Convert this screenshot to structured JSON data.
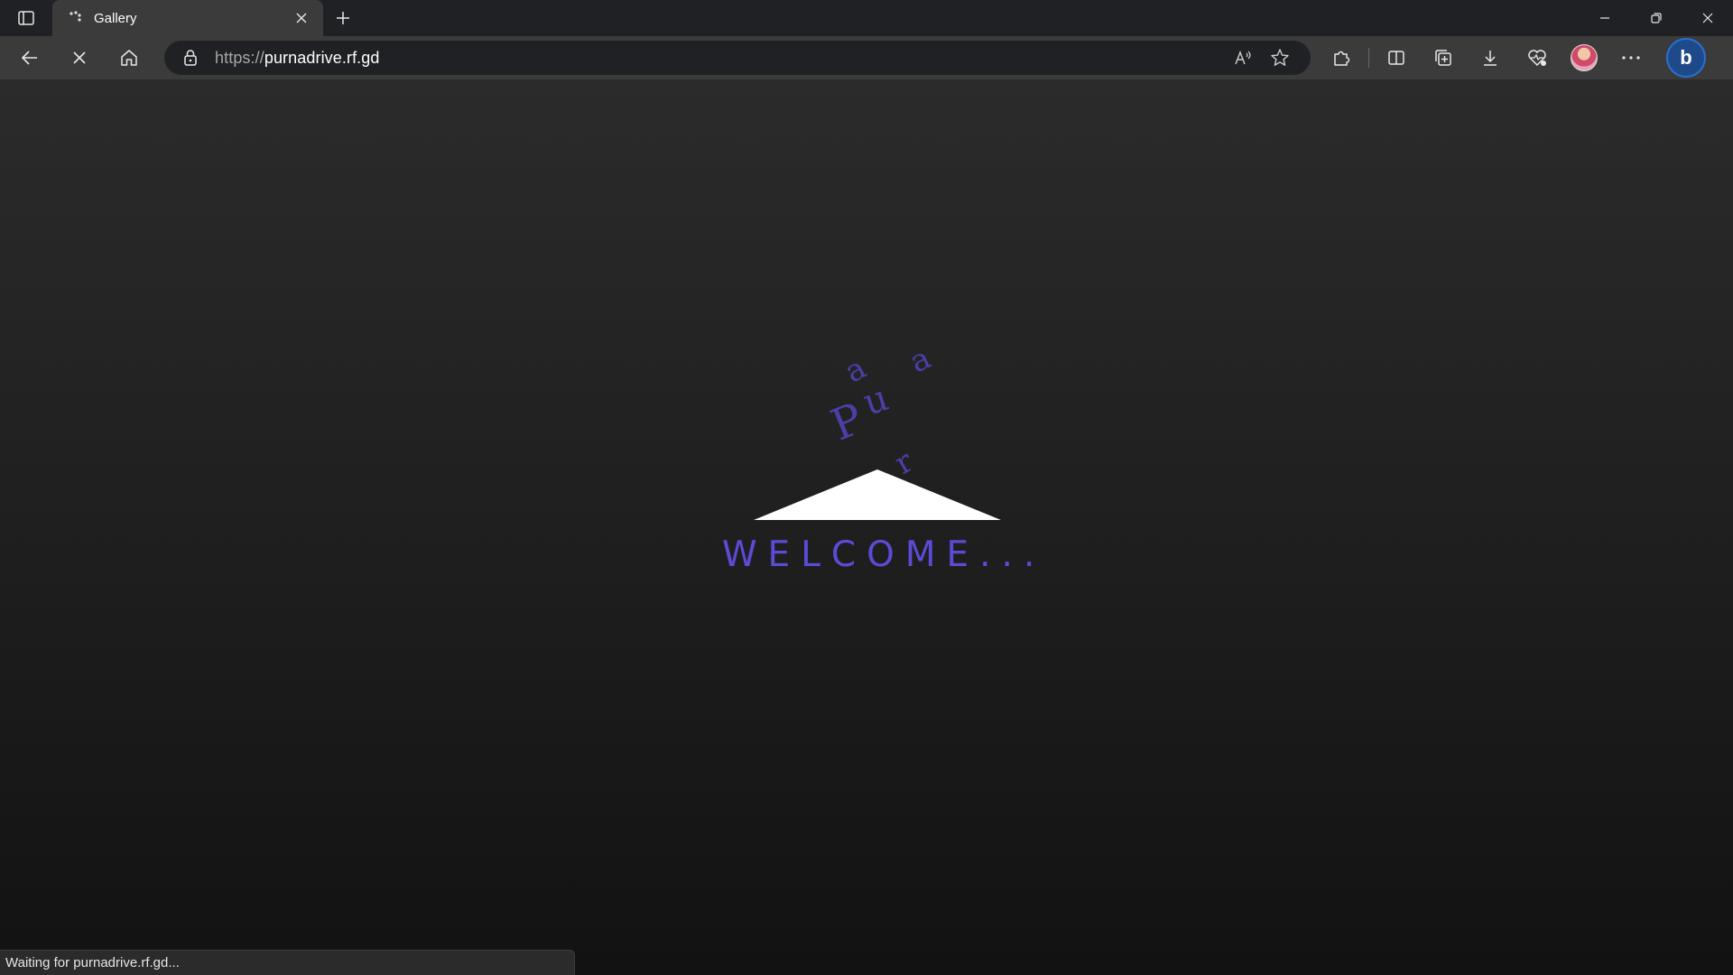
{
  "tab": {
    "title": "Gallery"
  },
  "address_bar": {
    "protocol": "https://",
    "host": "purnadrive.rf.gd"
  },
  "page": {
    "welcome_text": "WELCOME...",
    "loader_letters": [
      "P",
      "u",
      "a",
      "a",
      "r"
    ]
  },
  "status_bar": {
    "text": "Waiting for purnadrive.rf.gd..."
  },
  "icons": {
    "tab_actions": "tab-actions-icon",
    "favicon": "loading-spinner-icon",
    "close_tab": "close-icon",
    "new_tab": "plus-icon",
    "minimize": "minimize-icon",
    "restore": "restore-icon",
    "close_window": "close-icon",
    "back": "back-arrow-icon",
    "stop": "stop-icon",
    "home": "home-icon",
    "lock": "lock-icon",
    "read_aloud": "read-aloud-icon",
    "favorite": "star-icon",
    "extensions": "puzzle-icon",
    "split_screen": "split-screen-icon",
    "collections": "collections-icon",
    "downloads": "download-icon",
    "health": "browser-essentials-icon",
    "profile": "avatar",
    "more": "more-icon",
    "copilot": "bing-icon"
  },
  "colors": {
    "accent": "#5b4bd6",
    "letters": "#4a3fa8",
    "triangle": "#ffffff",
    "tab_active": "#3b3b3b",
    "tabstrip": "#202124"
  }
}
